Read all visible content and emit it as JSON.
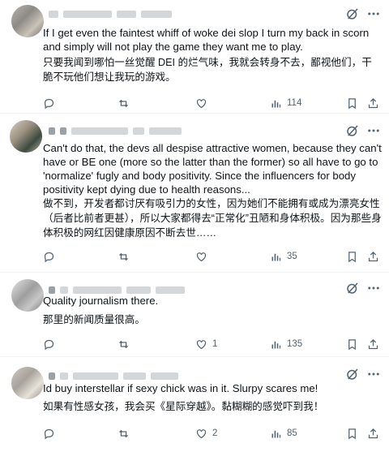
{
  "tweets": [
    {
      "text": "If I get even the faintest whiff of woke dei slop I turn my back in scorn and simply will not play the game they want me to play.",
      "translation": "只要我闻到哪怕一丝觉醒 DEI 的烂气味，我就会转身不去，鄙视他们，干脆不玩他们想让我玩的游戏。",
      "views": "114",
      "replies": "",
      "reposts": "",
      "likes": ""
    },
    {
      "text": "Can't do that, the devs all despise attractive women, because they can't have or BE one (more so the latter than the former) so all have to go to 'normalize' fugly and body positivity. Since the influencers for body positivity kept dying due to health reasons...",
      "translation": "做不到，开发者都讨厌有吸引力的女性，因为她们不能拥有或成为漂亮女性（后者比前者更甚），所以大家都得去“正常化”丑陋和身体积极。因为那些身体积极的网红因健康原因不断去世……",
      "views": "35",
      "replies": "",
      "reposts": "",
      "likes": ""
    },
    {
      "text": "Quality journalism there.",
      "translation": "那里的新闻质量很高。",
      "views": "135",
      "replies": "",
      "reposts": "",
      "likes": "1"
    },
    {
      "text": "Id buy interstellar if sexy chick was in it. Slurpy scares me!",
      "translation": "如果有性感女孩，我会买《星际穿越》。黏糊糊的感觉吓到我！",
      "views": "85",
      "replies": "",
      "reposts": "",
      "likes": "2"
    }
  ],
  "icons": {
    "reply": "reply-icon",
    "repost": "repost-icon",
    "like": "heart-icon",
    "views": "views-icon",
    "bookmark": "bookmark-icon",
    "share": "share-icon",
    "grok": "grok-icon",
    "more": "more-icon"
  },
  "colors": {
    "icon": "#536471",
    "text": "#0f1419",
    "divider": "#eff3f4"
  }
}
